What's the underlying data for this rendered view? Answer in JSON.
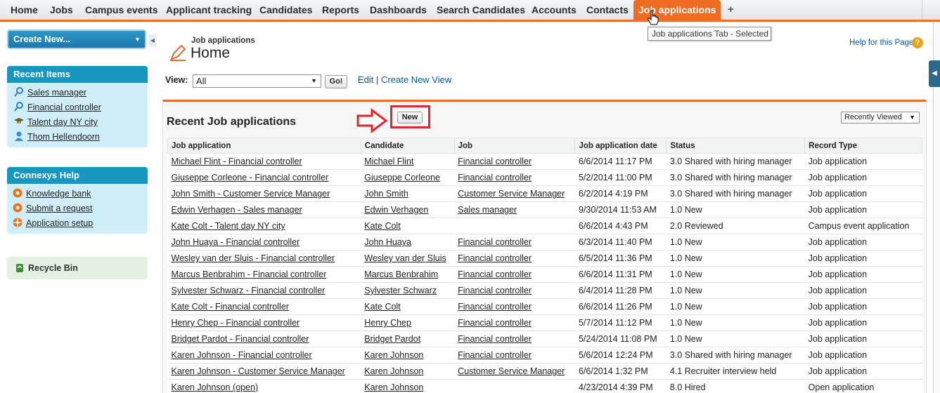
{
  "tabs": [
    {
      "label": "Home"
    },
    {
      "label": "Jobs"
    },
    {
      "label": "Campus events"
    },
    {
      "label": "Applicant tracking"
    },
    {
      "label": "Candidates"
    },
    {
      "label": "Reports"
    },
    {
      "label": "Dashboards"
    },
    {
      "label": "Search Candidates"
    },
    {
      "label": "Accounts"
    },
    {
      "label": "Contacts"
    },
    {
      "label": "Job applications",
      "active": true
    }
  ],
  "add_tab_symbol": "+",
  "tooltip": "Job applications Tab - Selected",
  "sidebar": {
    "create_new": "Create New...",
    "recent_items_title": "Recent Items",
    "recent_items": [
      {
        "label": "Sales manager",
        "icon": "job-search-icon"
      },
      {
        "label": "Financial controller",
        "icon": "job-search-icon"
      },
      {
        "label": "Talent day NY city",
        "icon": "graduation-cap-icon"
      },
      {
        "label": "Thom Hellendoorn",
        "icon": "person-icon"
      }
    ],
    "help_title": "Connexys Help",
    "help_items": [
      {
        "label": "Knowledge bank",
        "icon": "lifebuoy-icon"
      },
      {
        "label": "Submit a request",
        "icon": "lifebuoy-icon"
      },
      {
        "label": "Application setup",
        "icon": "gear-icon"
      }
    ],
    "recycle_bin": "Recycle Bin"
  },
  "header": {
    "object_label": "Job applications",
    "title": "Home",
    "help_link": "Help for this Page",
    "help_symbol": "?"
  },
  "view": {
    "label": "View:",
    "selected": "All",
    "go_button": "Go!",
    "edit_link": "Edit",
    "separator": "|",
    "create_link": "Create New View"
  },
  "recent_list": {
    "title": "Recent Job applications",
    "new_button": "New",
    "filter_selected": "Recently Viewed",
    "columns": [
      "Job application",
      "Candidate",
      "Job",
      "Job application date",
      "Status",
      "Record Type"
    ],
    "rows": [
      [
        "Michael Flint - Financial controller",
        "Michael Flint",
        "Financial controller",
        "6/6/2014 11:17 PM",
        "3.0 Shared with hiring manager",
        "Job application"
      ],
      [
        "Giuseppe Corleone - Financial controller",
        "Giuseppe Corleone",
        "Financial controller",
        "5/2/2014 11:00 PM",
        "3.0 Shared with hiring manager",
        "Job application"
      ],
      [
        "John Smith - Customer Service Manager",
        "John Smith",
        "Customer Service Manager",
        "6/2/2014 4:19 PM",
        "3.0 Shared with hiring manager",
        "Job application"
      ],
      [
        "Edwin Verhagen - Sales manager",
        "Edwin Verhagen",
        "Sales manager",
        "9/30/2014 11:53 AM",
        "1.0 New",
        "Job application"
      ],
      [
        "Kate Colt - Talent day NY city",
        "Kate Colt",
        "",
        "6/6/2014 4:43 PM",
        "2.0 Reviewed",
        "Campus event application"
      ],
      [
        "John Huaya - Financial controller",
        "John Huaya",
        "Financial controller",
        "6/3/2014 11:40 PM",
        "1.0 New",
        "Job application"
      ],
      [
        "Wesley van der Sluis - Financial controller",
        "Wesley van der Sluis",
        "Financial controller",
        "6/5/2014 11:36 PM",
        "1.0 New",
        "Job application"
      ],
      [
        "Marcus Benbrahim - Financial controller",
        "Marcus Benbrahim",
        "Financial controller",
        "6/6/2014 11:31 PM",
        "1.0 New",
        "Job application"
      ],
      [
        "Sylvester Schwarz - Financial controller",
        "Sylvester Schwarz",
        "Financial controller",
        "6/4/2014 11:28 PM",
        "1.0 New",
        "Job application"
      ],
      [
        "Kate Colt - Financial controller",
        "Kate Colt",
        "Financial controller",
        "6/6/2014 11:26 PM",
        "1.0 New",
        "Job application"
      ],
      [
        "Henry Chep - Financial controller",
        "Henry Chep",
        "Financial controller",
        "5/7/2014 11:12 PM",
        "1.0 New",
        "Job application"
      ],
      [
        "Bridget Pardot - Financial controller",
        "Bridget Pardot",
        "Financial controller",
        "5/24/2014 11:08 PM",
        "1.0 New",
        "Job application"
      ],
      [
        "Karen Johnson - Financial controller",
        "Karen Johnson",
        "Financial controller",
        "5/6/2014 12:24 PM",
        "3.0 Shared with hiring manager",
        "Job application"
      ],
      [
        "Karen Johnson - Customer Service Manager",
        "Karen Johnson",
        "Customer Service Manager",
        "6/6/2014 1:32 PM",
        "4.1 Recruiter interview held",
        "Job application"
      ],
      [
        "Karen Johnson (open)",
        "Karen Johnson",
        "",
        "4/23/2014 4:39 PM",
        "8.0 Hired",
        "Open application"
      ]
    ]
  },
  "colors": {
    "accent_orange": "#ef6c22",
    "sidebar_header_blue": "#1797c0",
    "sidebar_body_blue": "#cfeef8",
    "annotation_red": "#e0262b",
    "link_blue": "#015ba7"
  }
}
